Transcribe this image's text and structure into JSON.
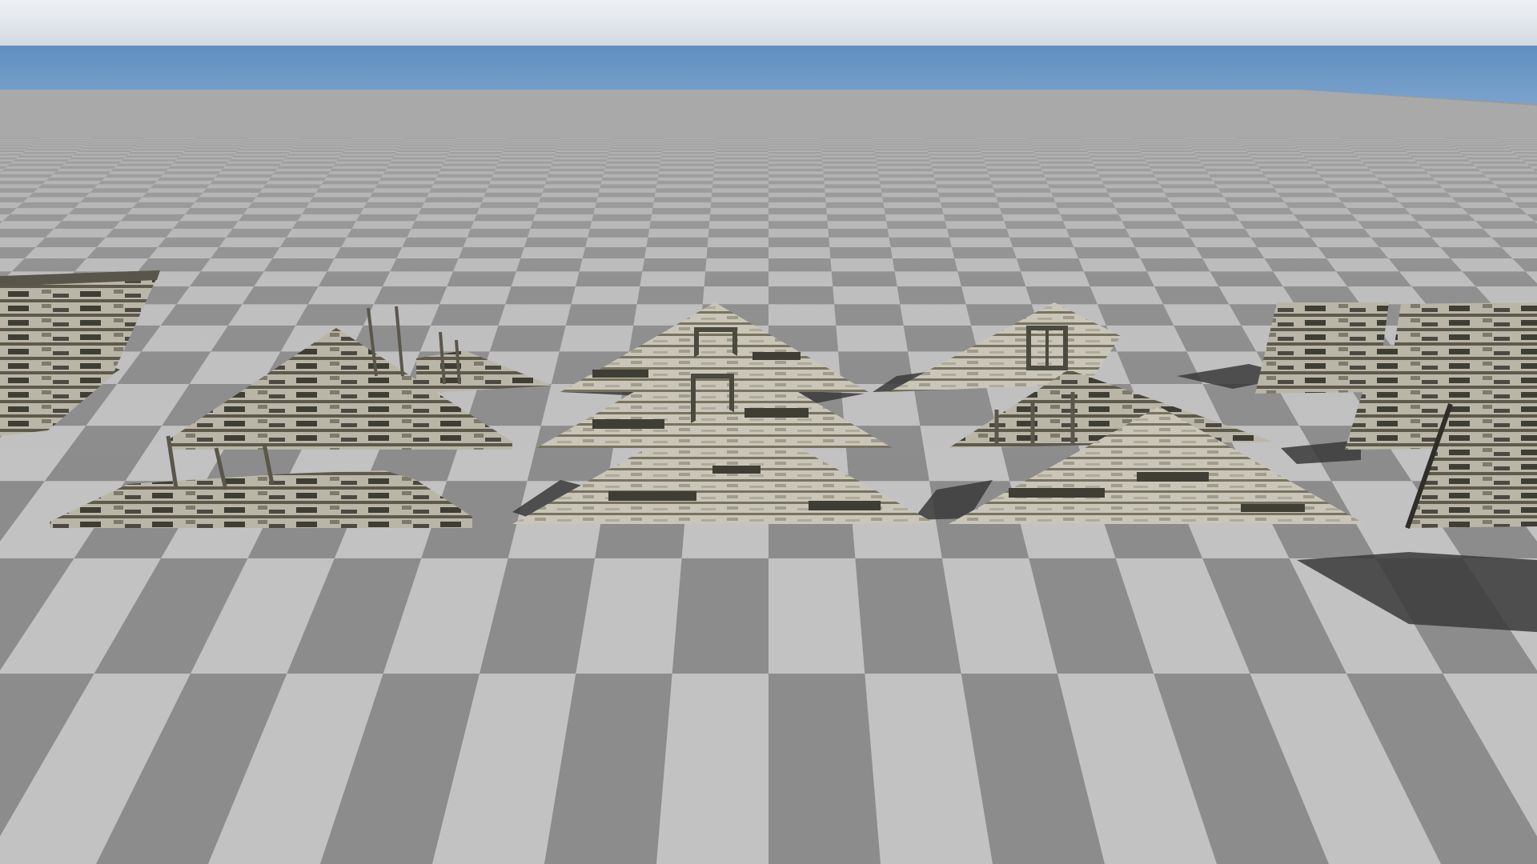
{
  "viewport": {
    "sky_colors": {
      "top": "#eef1f4",
      "haze": "#d9dde1",
      "band": "#5f8fbf",
      "band_light": "#8db1d4"
    },
    "floor_colors": {
      "light": "#c2c2c2",
      "dark": "#8c8c8c",
      "far_blend": "#a9a9a9"
    },
    "asset_colors": {
      "plank_light": "#c9c6b9",
      "plank_mid": "#9e9a8a",
      "plank_dark": "#4a4a3f",
      "shadow": "#3a3a3a"
    },
    "meshes": [
      {
        "name": "broken-wall-panel-far-left",
        "kind": "wall-panel",
        "condition": "damaged"
      },
      {
        "name": "collapsed-gable-back-left",
        "kind": "gable",
        "condition": "collapsed"
      },
      {
        "name": "collapsed-gable-mid-left",
        "kind": "gable",
        "condition": "collapsed"
      },
      {
        "name": "collapsed-gable-front-left",
        "kind": "gable",
        "condition": "collapsed"
      },
      {
        "name": "gable-with-door-back",
        "kind": "gable",
        "condition": "damaged"
      },
      {
        "name": "gable-with-door-mid",
        "kind": "gable",
        "condition": "damaged"
      },
      {
        "name": "gable-front-center",
        "kind": "gable",
        "condition": "damaged"
      },
      {
        "name": "gable-with-window-back",
        "kind": "gable",
        "condition": "damaged"
      },
      {
        "name": "gable-open-frame-mid",
        "kind": "gable",
        "condition": "damaged"
      },
      {
        "name": "gable-front-right",
        "kind": "gable",
        "condition": "damaged"
      },
      {
        "name": "wall-panel-back-right-1",
        "kind": "wall-panel",
        "condition": "damaged"
      },
      {
        "name": "wall-panel-back-right-2",
        "kind": "wall-panel",
        "condition": "damaged"
      },
      {
        "name": "wall-panel-mid-right",
        "kind": "wall-panel",
        "condition": "damaged"
      },
      {
        "name": "wall-panel-front-right",
        "kind": "wall-panel",
        "condition": "damaged"
      }
    ]
  }
}
